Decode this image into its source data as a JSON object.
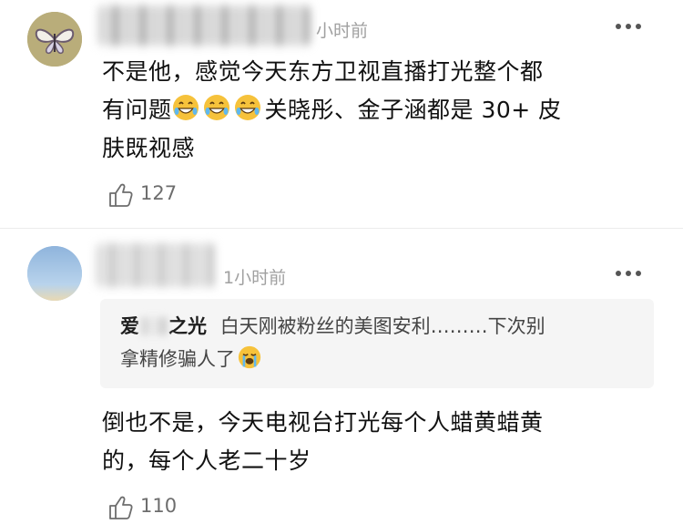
{
  "comments": [
    {
      "time": "小时前",
      "lines": [
        "不是他，感觉今天东方卫视直播打光整个都",
        "关晓彤、金子涵都是 30+ 皮",
        "肤既视感"
      ],
      "line2_prefix": "有问题",
      "emoji": [
        "grin-sweat-emoji",
        "grin-sweat-emoji",
        "grin-sweat-emoji"
      ],
      "likes": "127"
    },
    {
      "time": "1小时前",
      "quote": {
        "name_start": "爱",
        "name_end": "之光",
        "text": "白天刚被粉丝的美图安利………下次别",
        "text2": "拿精修骗人了",
        "emoji": "loudly-crying-emoji"
      },
      "lines": [
        "倒也不是，今天电视台打光每个人蜡黄蜡黄",
        "的，每个人老二十岁"
      ],
      "likes": "110"
    }
  ],
  "colors": {
    "quote_bg": "#f5f5f5",
    "muted": "#a0a0a0",
    "emoji": "#f6c23b"
  }
}
